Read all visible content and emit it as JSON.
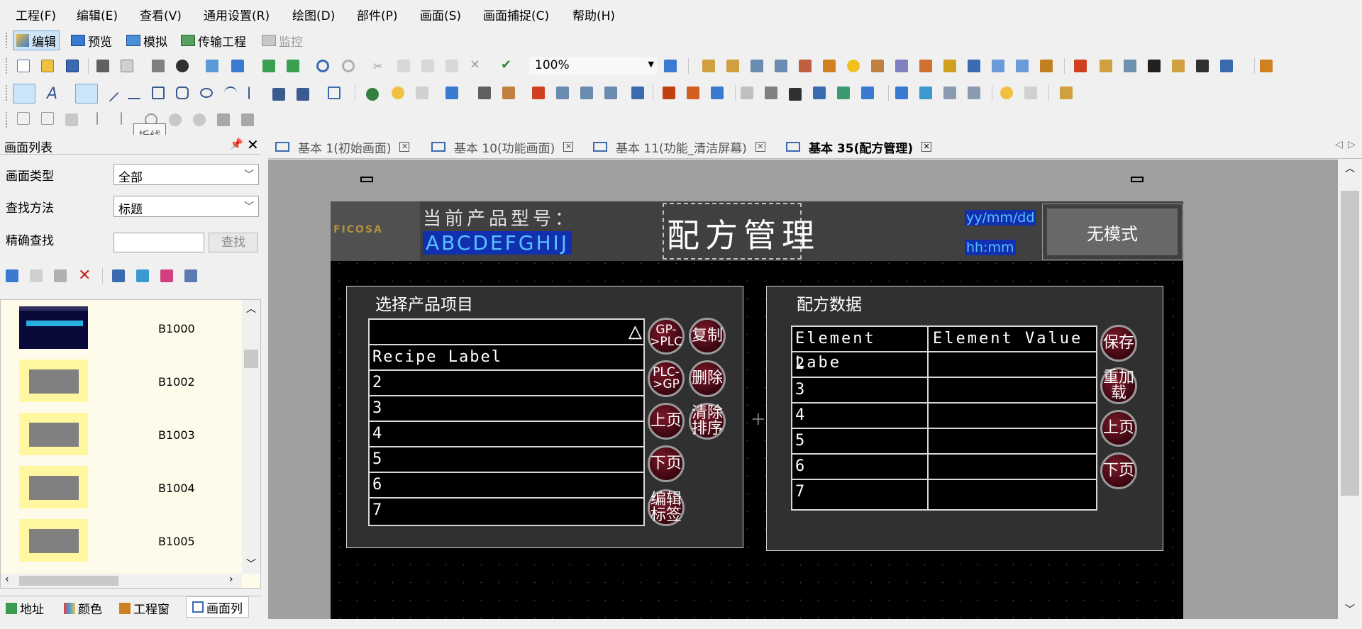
{
  "menu": [
    "工程(F)",
    "编辑(E)",
    "查看(V)",
    "通用设置(R)",
    "绘图(D)",
    "部件(P)",
    "画面(S)",
    "画面捕捉(C)",
    "帮助(H)"
  ],
  "modes": {
    "edit": "编辑",
    "preview": "预览",
    "simulate": "模拟",
    "transfer": "传输工程",
    "monitor": "监控"
  },
  "zoom": "100%",
  "tooltip": "折线",
  "left_panel": {
    "title": "画面列表",
    "type_label": "画面类型",
    "type_value": "全部",
    "method_label": "查找方法",
    "method_value": "标题",
    "exact_label": "精确查找",
    "find_button": "查找",
    "screens": [
      "B1000",
      "B1002",
      "B1003",
      "B1004",
      "B1005"
    ],
    "bottom_tabs": [
      "地址",
      "颜色",
      "工程窗",
      "画面列"
    ]
  },
  "tabs": [
    "基本 1(初始画面)",
    "基本 10(功能画面)",
    "基本 11(功能_清洁屏幕)",
    "基本 35(配方管理)"
  ],
  "hmi": {
    "current_product_label": "当前产品型号：",
    "product_code": "ABCDEFGHIJ",
    "title": "配方管理",
    "date": "yy/mm/dd",
    "time": "hh:mm",
    "mode_button": "无模式",
    "logo": "FICOSA",
    "left_group_title": "选择产品项目",
    "right_group_title": "配方数据",
    "triangle": "△",
    "recipe_header": "Recipe Label",
    "recipe_rows": [
      "2",
      "3",
      "4",
      "5",
      "6",
      "7"
    ],
    "data_header_label": "Element Labe",
    "data_header_value": "Element Value",
    "data_rows": [
      "2",
      "3",
      "4",
      "5",
      "6",
      "7"
    ],
    "btn_gp_plc": "GP->PLC",
    "btn_copy": "复制",
    "btn_plc_gp": "PLC->GP",
    "btn_delete": "删除",
    "btn_prev_left": "上页",
    "btn_clear_sort": "清除排序",
    "btn_next_left": "下页",
    "btn_edit_label": "编辑标签",
    "btn_save": "保存",
    "btn_reload": "重加载",
    "btn_prev_right": "上页",
    "btn_next_right": "下页"
  }
}
